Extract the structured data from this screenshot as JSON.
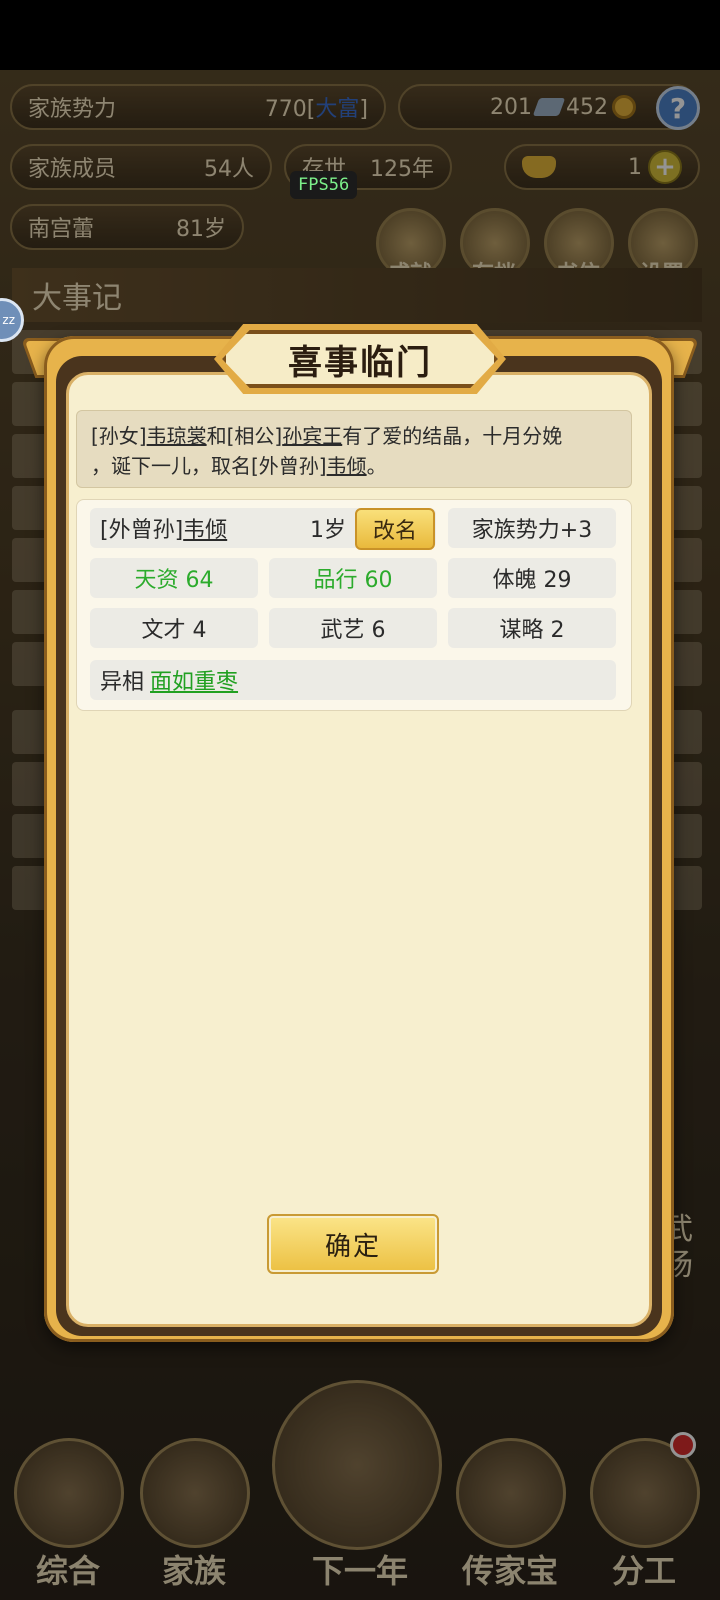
{
  "hud": {
    "clan_power_label": "家族势力",
    "clan_power_value": "770[",
    "clan_power_rank": "大富",
    "clan_power_close": "]",
    "currency_a": "201",
    "currency_b": "452",
    "members_label": "家族成员",
    "members_value": "54人",
    "alive_label": "存世",
    "alive_value": "125年",
    "gold_value": "1",
    "fps": "FPS56",
    "player_name": "南宫蕾",
    "player_age": "81岁"
  },
  "top_menu": [
    {
      "label": "成就",
      "icon": "achievement-icon"
    },
    {
      "label": "存档",
      "icon": "save-icon"
    },
    {
      "label": "书信",
      "icon": "letter-icon"
    },
    {
      "label": "设置",
      "icon": "settings-icon"
    }
  ],
  "chronicle_title": "大事记",
  "bottom_nav": [
    {
      "label": "综合"
    },
    {
      "label": "家族"
    },
    {
      "label": "下一年"
    },
    {
      "label": "传家宝"
    },
    {
      "label": "分工"
    }
  ],
  "side_label": "武场",
  "dialog": {
    "title": "喜事临门",
    "story": {
      "p1": "[孙女]",
      "n1": "韦琼裳",
      "p2": "和[相公]",
      "n2": "孙宾王",
      "p3": "有了爱的结晶，十月分娩",
      "p4": "，诞下一儿，取名[外曾孙]",
      "n3": "韦倾",
      "p5": "。"
    },
    "child": {
      "relation": "[外曾孙]",
      "name": "韦倾",
      "age": "1岁",
      "rename_label": "改名",
      "clan_power_bonus": "家族势力+3"
    },
    "stats": {
      "talent": "天资 64",
      "conduct": "品行 60",
      "physique": "体魄 29",
      "literary": "文才 4",
      "martial": "武艺 6",
      "strategy": "谋略 2"
    },
    "trait_label": "异相",
    "trait_value": "面如重枣",
    "confirm_label": "确定"
  }
}
